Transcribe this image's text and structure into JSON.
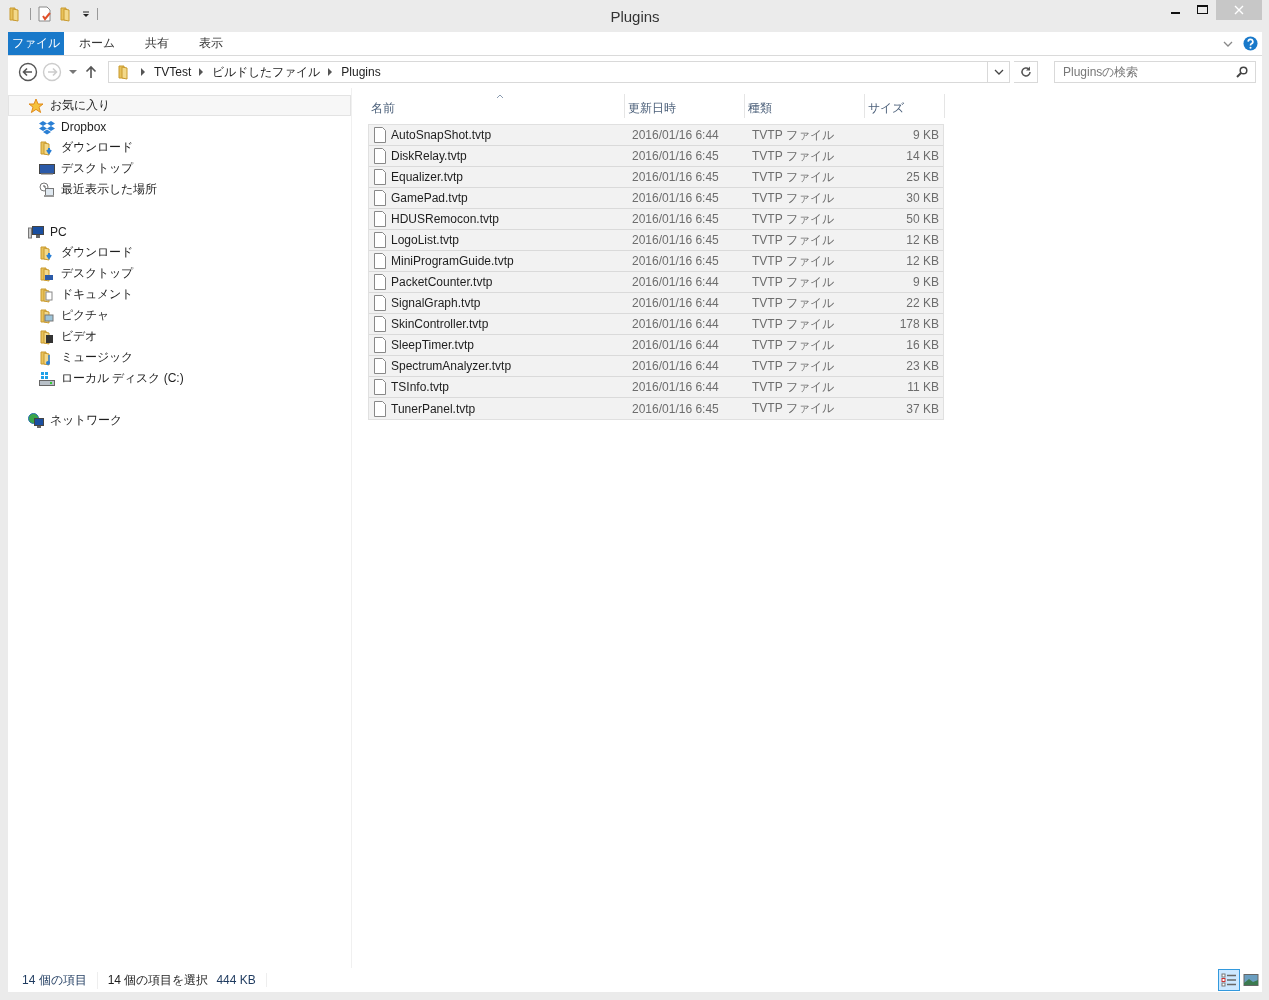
{
  "window": {
    "title": "Plugins"
  },
  "ribbon_tabs": [
    {
      "label": "ファイル",
      "kind": "file"
    },
    {
      "label": "ホーム",
      "kind": "tab"
    },
    {
      "label": "共有",
      "kind": "tab"
    },
    {
      "label": "表示",
      "kind": "tab"
    }
  ],
  "address_bar": {
    "path": [
      "TVTest",
      "ビルドしたファイル",
      "Plugins"
    ]
  },
  "search": {
    "placeholder": "Pluginsの検索"
  },
  "sidebar": {
    "groups": [
      {
        "label": "お気に入り",
        "highlighted": true,
        "children": [
          {
            "label": "Dropbox"
          },
          {
            "label": "ダウンロード"
          },
          {
            "label": "デスクトップ"
          },
          {
            "label": "最近表示した場所"
          }
        ]
      },
      {
        "label": "PC",
        "highlighted": false,
        "children": [
          {
            "label": "ダウンロード"
          },
          {
            "label": "デスクトップ"
          },
          {
            "label": "ドキュメント"
          },
          {
            "label": "ピクチャ"
          },
          {
            "label": "ビデオ"
          },
          {
            "label": "ミュージック"
          },
          {
            "label": "ローカル ディスク (C:)"
          }
        ]
      },
      {
        "label": "ネットワーク",
        "highlighted": false
      }
    ]
  },
  "file_list": {
    "columns": [
      {
        "label": "名前",
        "sorted": true
      },
      {
        "label": "更新日時",
        "sorted": false
      },
      {
        "label": "種類",
        "sorted": false
      },
      {
        "label": "サイズ",
        "sorted": false
      }
    ],
    "rows": [
      {
        "name": "AutoSnapShot.tvtp",
        "modified": "2016/01/16 6:44",
        "type": "TVTP ファイル",
        "size": "9 KB",
        "selected": true
      },
      {
        "name": "DiskRelay.tvtp",
        "modified": "2016/01/16 6:45",
        "type": "TVTP ファイル",
        "size": "14 KB",
        "selected": true
      },
      {
        "name": "Equalizer.tvtp",
        "modified": "2016/01/16 6:45",
        "type": "TVTP ファイル",
        "size": "25 KB",
        "selected": true
      },
      {
        "name": "GamePad.tvtp",
        "modified": "2016/01/16 6:45",
        "type": "TVTP ファイル",
        "size": "30 KB",
        "selected": true
      },
      {
        "name": "HDUSRemocon.tvtp",
        "modified": "2016/01/16 6:45",
        "type": "TVTP ファイル",
        "size": "50 KB",
        "selected": true
      },
      {
        "name": "LogoList.tvtp",
        "modified": "2016/01/16 6:45",
        "type": "TVTP ファイル",
        "size": "12 KB",
        "selected": true
      },
      {
        "name": "MiniProgramGuide.tvtp",
        "modified": "2016/01/16 6:45",
        "type": "TVTP ファイル",
        "size": "12 KB",
        "selected": true
      },
      {
        "name": "PacketCounter.tvtp",
        "modified": "2016/01/16 6:44",
        "type": "TVTP ファイル",
        "size": "9 KB",
        "selected": true
      },
      {
        "name": "SignalGraph.tvtp",
        "modified": "2016/01/16 6:44",
        "type": "TVTP ファイル",
        "size": "22 KB",
        "selected": true
      },
      {
        "name": "SkinController.tvtp",
        "modified": "2016/01/16 6:44",
        "type": "TVTP ファイル",
        "size": "178 KB",
        "selected": true
      },
      {
        "name": "SleepTimer.tvtp",
        "modified": "2016/01/16 6:44",
        "type": "TVTP ファイル",
        "size": "16 KB",
        "selected": true
      },
      {
        "name": "SpectrumAnalyzer.tvtp",
        "modified": "2016/01/16 6:44",
        "type": "TVTP ファイル",
        "size": "23 KB",
        "selected": true
      },
      {
        "name": "TSInfo.tvtp",
        "modified": "2016/01/16 6:44",
        "type": "TVTP ファイル",
        "size": "11 KB",
        "selected": true
      },
      {
        "name": "TunerPanel.tvtp",
        "modified": "2016/01/16 6:45",
        "type": "TVTP ファイル",
        "size": "37 KB",
        "selected": true
      }
    ]
  },
  "status_bar": {
    "item_count": "14 個の項目",
    "selection": "14 個の項目を選択",
    "selection_size": "444 KB",
    "views": [
      {
        "kind": "details",
        "selected": true
      },
      {
        "kind": "large-icons",
        "selected": false
      }
    ]
  }
}
